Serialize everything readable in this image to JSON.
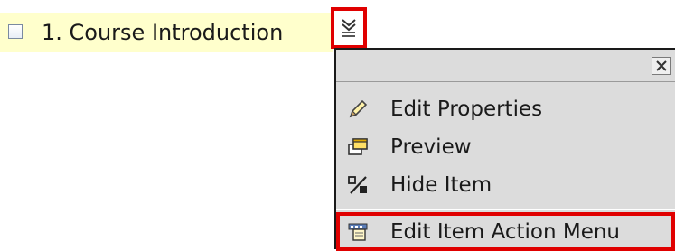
{
  "course_item": {
    "title": "1. Course Introduction"
  },
  "action_menu": {
    "items": [
      {
        "label": "Edit Properties",
        "icon": "pencil-icon"
      },
      {
        "label": "Preview",
        "icon": "preview-window-icon"
      },
      {
        "label": "Hide Item",
        "icon": "hide-item-icon"
      },
      {
        "label": "Edit Item Action Menu",
        "icon": "menu-editor-icon"
      }
    ],
    "close_icon": "close-icon"
  },
  "colors": {
    "highlight_border": "#e00000",
    "item_row_background": "#ffffcc",
    "menu_background": "#dcdcdc"
  }
}
